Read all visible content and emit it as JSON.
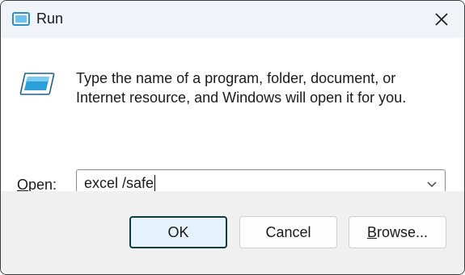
{
  "window": {
    "title": "Run",
    "icon": "run-app-icon",
    "close_icon": "close-icon"
  },
  "body": {
    "description_line1": "Type the name of a program, folder, document, or",
    "description_line2": "Internet resource, and Windows will open it for you.",
    "open_label_prefix": "",
    "open_label_accesskey": "O",
    "open_label_rest": "pen:",
    "open_value": "excel /safe"
  },
  "buttons": {
    "ok": "OK",
    "cancel": "Cancel",
    "browse_accesskey": "B",
    "browse_rest": "rowse..."
  },
  "colors": {
    "titlebar": "#f0f4f9",
    "footer": "#f0f0f0",
    "ok_border": "#0f3d3d",
    "ok_fill": "#e5f1fb",
    "run_icon_accent": "#2b9fd9"
  }
}
